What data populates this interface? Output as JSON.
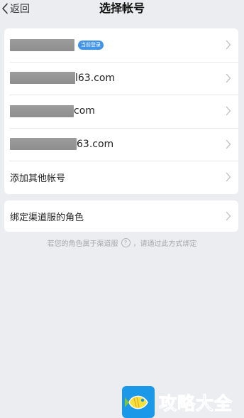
{
  "nav": {
    "back_label": "返回",
    "title": "选择帐号"
  },
  "accounts": [
    {
      "visible_text": "",
      "badge": "当前登录"
    },
    {
      "visible_text": "l63.com"
    },
    {
      "visible_text": "com"
    },
    {
      "visible_text": "63.com"
    }
  ],
  "add_account_label": "添加其他帐号",
  "channel": {
    "label": "绑定渠道服的角色",
    "hint_before": "若您的角色属于渠道服",
    "hint_qmark": "?",
    "hint_after": "，请通过此方式绑定"
  },
  "watermark": {
    "text": "攻略大全"
  },
  "colors": {
    "background": "#ecedf1",
    "badge": "#3f94e8",
    "watermark": "#1c93e3"
  }
}
